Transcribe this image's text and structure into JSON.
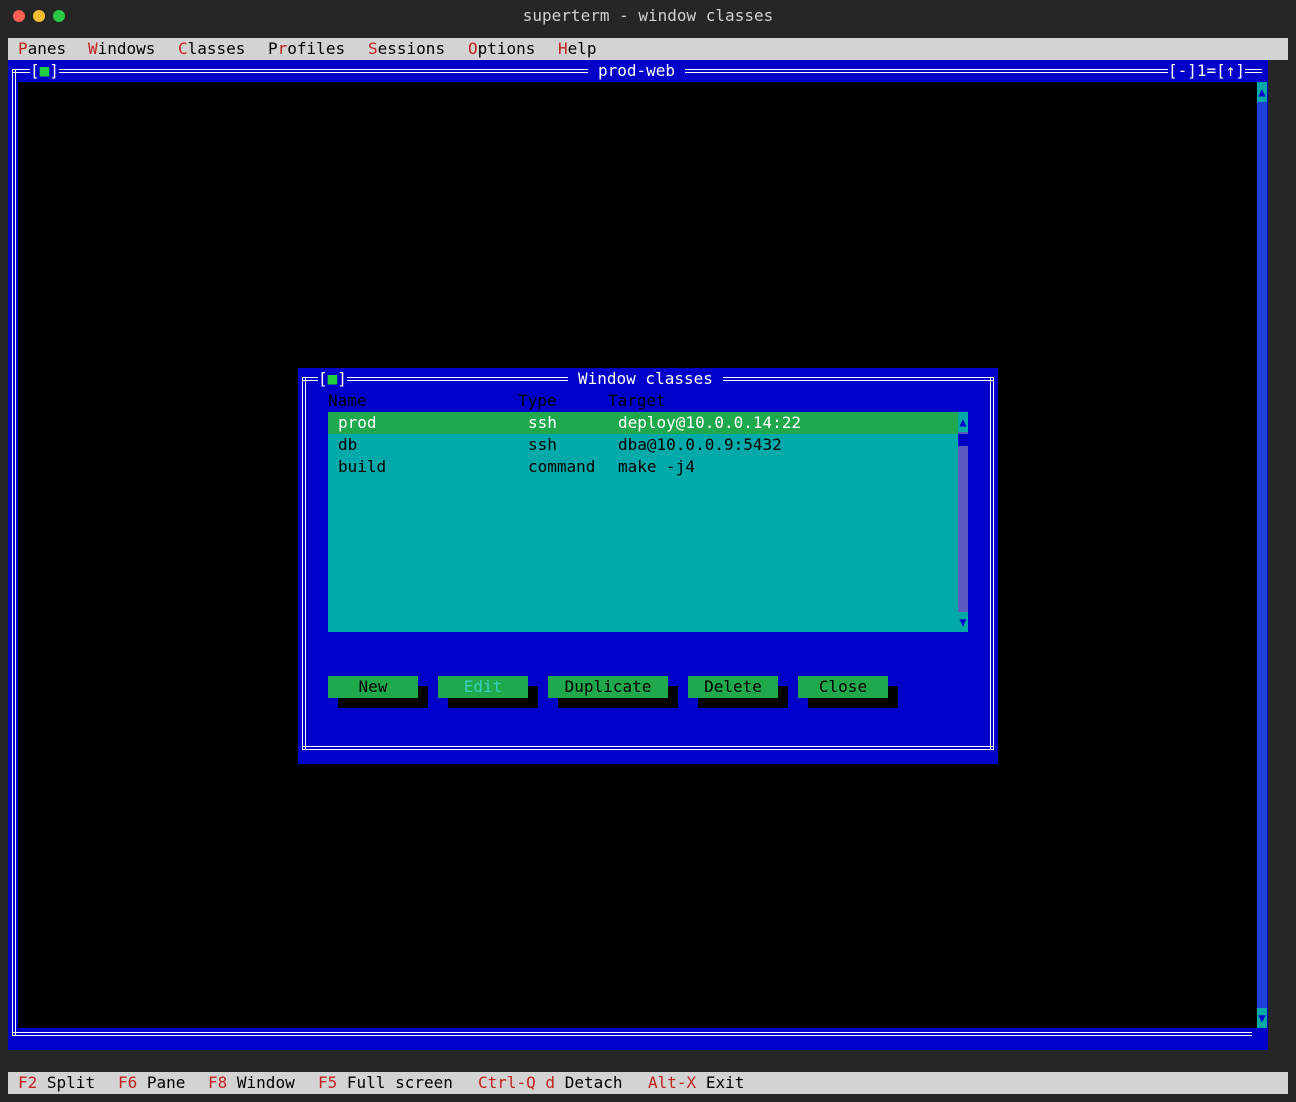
{
  "window": {
    "title": "superterm - window classes",
    "colors": {
      "close": "#ff5f57",
      "minimize": "#febc2e",
      "maximize": "#28c840"
    }
  },
  "menubar": [
    {
      "hotkey": "P",
      "rest": "anes"
    },
    {
      "hotkey": "W",
      "rest": "indows"
    },
    {
      "hotkey": "C",
      "rest": "lasses"
    },
    {
      "prefix": "P",
      "hotkey": "r",
      "rest": "ofiles"
    },
    {
      "hotkey": "S",
      "rest": "essions"
    },
    {
      "hotkey": "O",
      "rest": "ptions"
    },
    {
      "hotkey": "H",
      "rest": "elp"
    }
  ],
  "main_window": {
    "title": "prod-web",
    "close_box": "■",
    "controls": "[-]1=[↑]",
    "scroll_up": "▲",
    "scroll_down": "▼"
  },
  "dialog": {
    "title": "Window classes",
    "close_box": "■",
    "columns": {
      "name": "Name",
      "type": "Type",
      "target": "Target"
    },
    "rows": [
      {
        "name": "prod",
        "type": "ssh",
        "target": "deploy@10.0.0.14:22",
        "selected": true
      },
      {
        "name": "db",
        "type": "ssh",
        "target": "dba@10.0.0.9:5432",
        "selected": false
      },
      {
        "name": "build",
        "type": "command",
        "target": "make -j4",
        "selected": false
      }
    ],
    "scroll_up": "▲",
    "scroll_down": "▼",
    "buttons": {
      "new": "New",
      "edit": "Edit",
      "duplicate": "Duplicate",
      "delete": "Delete",
      "close": "Close"
    }
  },
  "statusbar": [
    {
      "key": "F2",
      "label": "Split"
    },
    {
      "key": "F6",
      "label": "Pane"
    },
    {
      "key": "F8",
      "label": "Window"
    },
    {
      "key": "F5",
      "label": "Full screen"
    },
    {
      "key": "Ctrl-Q d",
      "label": "Detach"
    },
    {
      "key": "Alt-X",
      "label": "Exit"
    }
  ]
}
